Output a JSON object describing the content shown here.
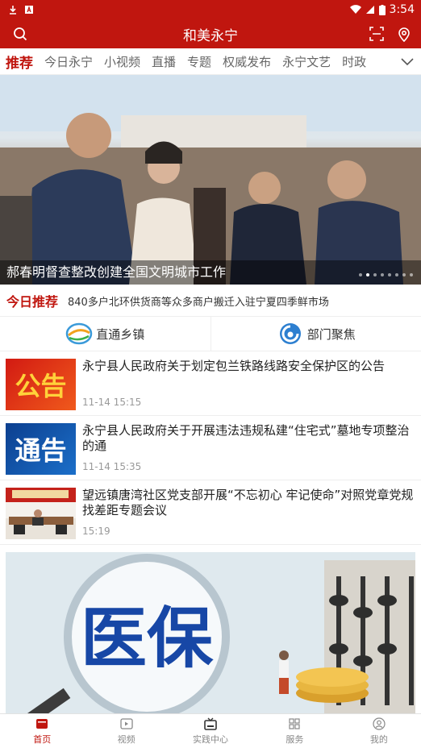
{
  "status": {
    "time": "3:54"
  },
  "appbar": {
    "title": "和美永宁"
  },
  "tabs": [
    "推荐",
    "今日永宁",
    "小视频",
    "直播",
    "专题",
    "权威发布",
    "永宁文艺",
    "时政"
  ],
  "hero": {
    "caption": "郝春明督查整改创建全国文明城市工作",
    "slide_index": 1,
    "slide_count": 8
  },
  "ticker": {
    "tag": "今日推荐",
    "text": "840多户北环供货商等众多商户搬迁入驻宁夏四季鲜市场"
  },
  "quick": [
    {
      "label": "直通乡镇",
      "icon": "town-logo-icon"
    },
    {
      "label": "部门聚焦",
      "icon": "department-logo-icon"
    }
  ],
  "articles": [
    {
      "title": "永宁县人民政府关于划定包兰铁路线路安全保护区的公告",
      "time": "11-14 15:15",
      "thumb_text": "公告"
    },
    {
      "title": "永宁县人民政府关于开展违法违规私建“住宅式”墓地专项整治的通",
      "time": "11-14 15:35",
      "thumb_text": "通告"
    },
    {
      "title": "望远镇唐湾社区党支部开展“不忘初心 牢记使命”对照党章党规找差距专题会议",
      "time": "15:19",
      "thumb_text": ""
    }
  ],
  "feature_image": {
    "text": "医保"
  },
  "bottom_nav": [
    {
      "label": "首页",
      "icon": "home-icon",
      "active": true
    },
    {
      "label": "视频",
      "icon": "video-icon",
      "active": false
    },
    {
      "label": "实践中心",
      "icon": "tv-icon",
      "active": false
    },
    {
      "label": "服务",
      "icon": "grid-icon",
      "active": false
    },
    {
      "label": "我的",
      "icon": "user-icon",
      "active": false
    }
  ],
  "colors": {
    "brand": "#c0160f"
  }
}
